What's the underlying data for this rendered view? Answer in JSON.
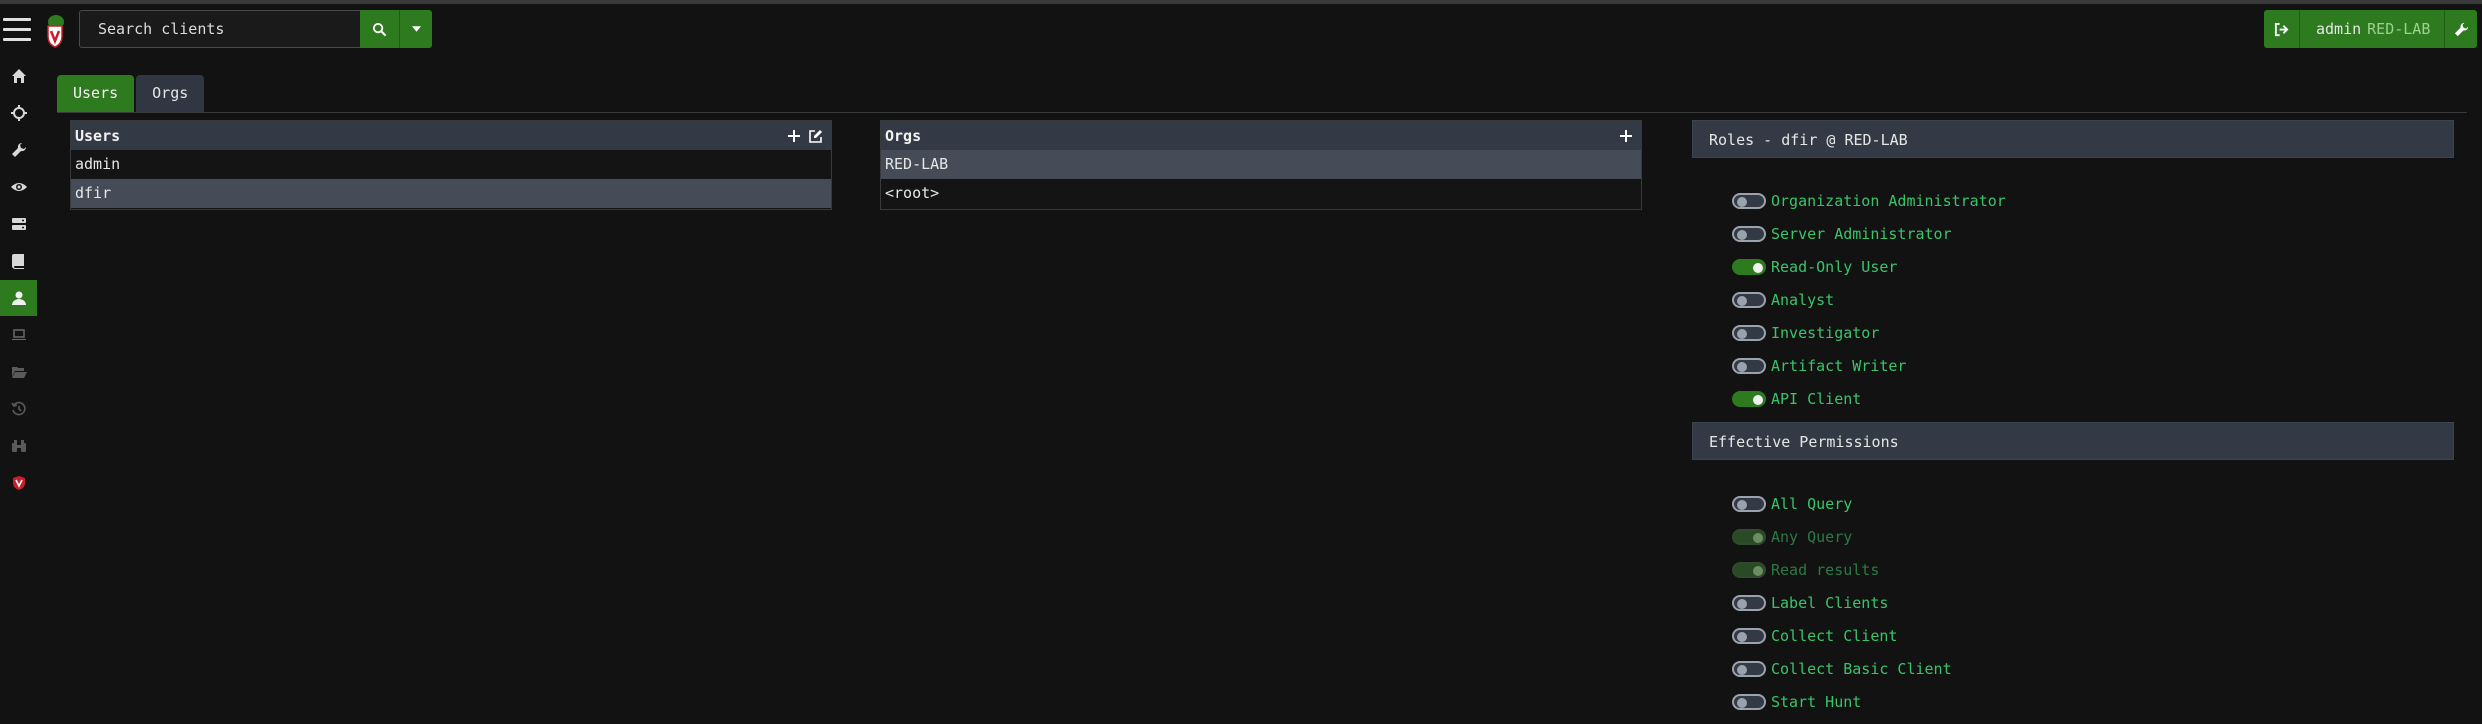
{
  "search": {
    "placeholder": "Search clients"
  },
  "user_menu": {
    "username": "admin",
    "org": "RED-LAB"
  },
  "sidebar": {
    "items": [
      {
        "icon": "home-icon"
      },
      {
        "icon": "crosshair-icon"
      },
      {
        "icon": "wrench-icon"
      },
      {
        "icon": "eye-icon"
      },
      {
        "icon": "server-icon"
      },
      {
        "icon": "book-icon"
      },
      {
        "icon": "user-icon",
        "active": true
      },
      {
        "icon": "laptop-icon"
      },
      {
        "icon": "folder-open-icon"
      },
      {
        "icon": "history-icon"
      },
      {
        "icon": "binoculars-icon"
      },
      {
        "icon": "velociraptor-shield-icon"
      }
    ]
  },
  "tabs": [
    {
      "label": "Users",
      "active": true
    },
    {
      "label": "Orgs",
      "active": false
    }
  ],
  "users_panel": {
    "title": "Users",
    "rows": [
      "admin",
      "dfir"
    ],
    "selected": "dfir"
  },
  "orgs_panel": {
    "title": "Orgs",
    "rows": [
      "RED-LAB",
      "<root>"
    ],
    "selected": "RED-LAB"
  },
  "roles": {
    "title": "Roles - dfir @ RED-LAB",
    "items": [
      {
        "label": "Organization Administrator",
        "state": "off"
      },
      {
        "label": "Server Administrator",
        "state": "off"
      },
      {
        "label": "Read-Only User",
        "state": "on"
      },
      {
        "label": "Analyst",
        "state": "off"
      },
      {
        "label": "Investigator",
        "state": "off"
      },
      {
        "label": "Artifact Writer",
        "state": "off"
      },
      {
        "label": "API Client",
        "state": "on"
      }
    ]
  },
  "permissions": {
    "title": "Effective Permissions",
    "items": [
      {
        "label": "All Query",
        "state": "off"
      },
      {
        "label": "Any Query",
        "state": "disabled"
      },
      {
        "label": "Read results",
        "state": "disabled"
      },
      {
        "label": "Label Clients",
        "state": "off"
      },
      {
        "label": "Collect Client",
        "state": "off"
      },
      {
        "label": "Collect Basic Client",
        "state": "off"
      },
      {
        "label": "Start Hunt",
        "state": "off"
      }
    ]
  },
  "colors": {
    "accent": "#2d7a1f",
    "label_green": "#39c46a",
    "panel_header": "#343a45",
    "background": "#121212"
  }
}
